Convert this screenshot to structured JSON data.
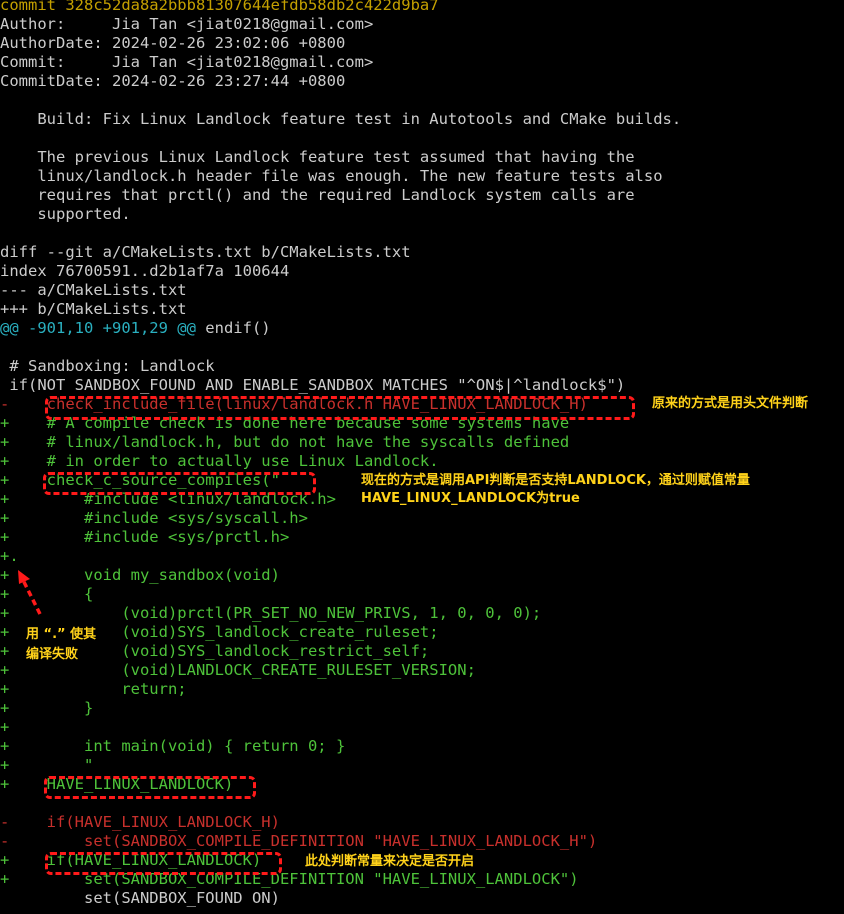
{
  "colors": {
    "background": "#000000",
    "commit": "#c4a000",
    "plain": "#cccccc",
    "hunk": "#2ab0c0",
    "removed": "#c8302c",
    "added": "#4ec23a",
    "annotation_box": "#ff1a1a",
    "annotation_text": "#ffd21a"
  },
  "lines": [
    {
      "t": "commit 328c52da8a2bbb81307644efdb58db2c422d9ba7",
      "k": "commit"
    },
    {
      "t": "Author:     Jia Tan <jiat0218@gmail.com>",
      "k": "plain"
    },
    {
      "t": "AuthorDate: 2024-02-26 23:02:06 +0800",
      "k": "plain"
    },
    {
      "t": "Commit:     Jia Tan <jiat0218@gmail.com>",
      "k": "plain"
    },
    {
      "t": "CommitDate: 2024-02-26 23:27:44 +0800",
      "k": "plain"
    },
    {
      "t": "",
      "k": "plain"
    },
    {
      "t": "    Build: Fix Linux Landlock feature test in Autotools and CMake builds.",
      "k": "plain"
    },
    {
      "t": "",
      "k": "plain"
    },
    {
      "t": "    The previous Linux Landlock feature test assumed that having the",
      "k": "plain"
    },
    {
      "t": "    linux/landlock.h header file was enough. The new feature tests also",
      "k": "plain"
    },
    {
      "t": "    requires that prctl() and the required Landlock system calls are",
      "k": "plain"
    },
    {
      "t": "    supported.",
      "k": "plain"
    },
    {
      "t": "",
      "k": "plain"
    },
    {
      "t": "diff --git a/CMakeLists.txt b/CMakeLists.txt",
      "k": "plain"
    },
    {
      "t": "index 76700591..d2b1af7a 100644",
      "k": "plain"
    },
    {
      "t": "--- a/CMakeLists.txt",
      "k": "plain"
    },
    {
      "t": "+++ b/CMakeLists.txt",
      "k": "plain"
    },
    {
      "t": "@@ -901,10 +901,29 @@",
      "k": "hunk",
      "rest": " endif()"
    },
    {
      "t": "",
      "k": "plain"
    },
    {
      "t": " # Sandboxing: Landlock",
      "k": "plain"
    },
    {
      "t": " if(NOT SANDBOX_FOUND AND ENABLE_SANDBOX MATCHES \"^ON$|^landlock$\")",
      "k": "plain"
    },
    {
      "t": "-    check_include_file(linux/landlock.h HAVE_LINUX_LANDLOCK_H)",
      "k": "del"
    },
    {
      "t": "+    # A compile check is done here because some systems have",
      "k": "add"
    },
    {
      "t": "+    # linux/landlock.h, but do not have the syscalls defined",
      "k": "add"
    },
    {
      "t": "+    # in order to actually use Linux Landlock.",
      "k": "add"
    },
    {
      "t": "+    check_c_source_compiles(\"",
      "k": "add"
    },
    {
      "t": "+        #include <linux/landlock.h>",
      "k": "add"
    },
    {
      "t": "+        #include <sys/syscall.h>",
      "k": "add"
    },
    {
      "t": "+        #include <sys/prctl.h>",
      "k": "add"
    },
    {
      "t": "+.",
      "k": "add"
    },
    {
      "t": "+        void my_sandbox(void)",
      "k": "add"
    },
    {
      "t": "+        {",
      "k": "add"
    },
    {
      "t": "+            (void)prctl(PR_SET_NO_NEW_PRIVS, 1, 0, 0, 0);",
      "k": "add"
    },
    {
      "t": "+            (void)SYS_landlock_create_ruleset;",
      "k": "add"
    },
    {
      "t": "+            (void)SYS_landlock_restrict_self;",
      "k": "add"
    },
    {
      "t": "+            (void)LANDLOCK_CREATE_RULESET_VERSION;",
      "k": "add"
    },
    {
      "t": "+            return;",
      "k": "add"
    },
    {
      "t": "+        }",
      "k": "add"
    },
    {
      "t": "+",
      "k": "add"
    },
    {
      "t": "+        int main(void) { return 0; }",
      "k": "add"
    },
    {
      "t": "+        \"",
      "k": "add"
    },
    {
      "t": "+    HAVE_LINUX_LANDLOCK)",
      "k": "add"
    },
    {
      "t": "",
      "k": "plain"
    },
    {
      "t": "-    if(HAVE_LINUX_LANDLOCK_H)",
      "k": "del"
    },
    {
      "t": "-        set(SANDBOX_COMPILE_DEFINITION \"HAVE_LINUX_LANDLOCK_H\")",
      "k": "del"
    },
    {
      "t": "+    if(HAVE_LINUX_LANDLOCK)",
      "k": "add"
    },
    {
      "t": "+        set(SANDBOX_COMPILE_DEFINITION \"HAVE_LINUX_LANDLOCK\")",
      "k": "add"
    },
    {
      "t": "         set(SANDBOX_FOUND ON)",
      "k": "plain"
    }
  ],
  "annotations": {
    "old_method": "原来的方式是用头文件判断",
    "new_method_line1": "现在的方式是调用API判断是否支持LANDLOCK，通过则赋值常量",
    "new_method_line2": "HAVE_LINUX_LANDLOCK为true",
    "dot_note_line1": "用 “.” 使其",
    "dot_note_line2": "编译失败",
    "decide_note": "此处判断常量来决定是否开启"
  }
}
